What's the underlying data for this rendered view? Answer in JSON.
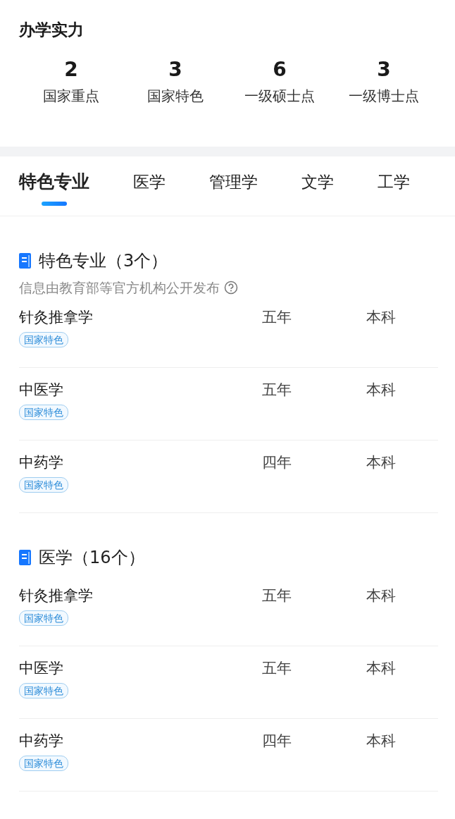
{
  "title": "办学实力",
  "stats": [
    {
      "value": "2",
      "label": "国家重点"
    },
    {
      "value": "3",
      "label": "国家特色"
    },
    {
      "value": "6",
      "label": "一级硕士点"
    },
    {
      "value": "3",
      "label": "一级博士点"
    }
  ],
  "tabs": [
    {
      "label": "特色专业",
      "selected": true
    },
    {
      "label": "医学",
      "selected": false
    },
    {
      "label": "管理学",
      "selected": false
    },
    {
      "label": "文学",
      "selected": false
    },
    {
      "label": "工学",
      "selected": false
    }
  ],
  "sections": [
    {
      "title": "特色专业（3个）",
      "note": "信息由教育部等官方机构公开发布",
      "rows": [
        {
          "name": "针灸推拿学",
          "years": "五年",
          "degree": "本科",
          "tag": "国家特色"
        },
        {
          "name": "中医学",
          "years": "五年",
          "degree": "本科",
          "tag": "国家特色"
        },
        {
          "name": "中药学",
          "years": "四年",
          "degree": "本科",
          "tag": "国家特色"
        }
      ]
    },
    {
      "title": "医学（16个）",
      "rows": [
        {
          "name": "针灸推拿学",
          "years": "五年",
          "degree": "本科",
          "tag": "国家特色"
        },
        {
          "name": "中医学",
          "years": "五年",
          "degree": "本科",
          "tag": "国家特色"
        },
        {
          "name": "中药学",
          "years": "四年",
          "degree": "本科",
          "tag": "国家特色"
        }
      ]
    }
  ]
}
